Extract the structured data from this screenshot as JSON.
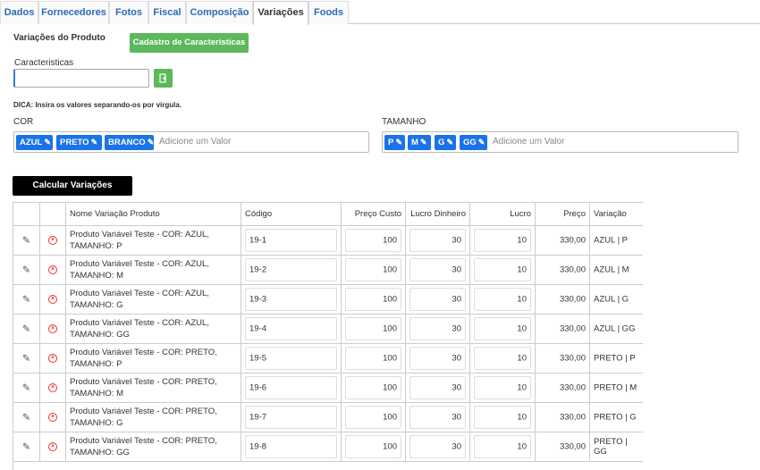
{
  "tabs": [
    "Dados",
    "Fornecedores",
    "Fotos",
    "Fiscal",
    "Composição",
    "Variações",
    "Foods"
  ],
  "active_tab": "Variações",
  "section_title": "Variações do Produto",
  "cadastro_button": "Cadastro de Características",
  "caracteristicas_label": "Caracteristicas",
  "caracteristicas_value": "",
  "dica": "DICA: Insira os valores separando-os por vírgula.",
  "cor": {
    "label": "COR",
    "tags": [
      "AZUL",
      "PRETO",
      "BRANCO"
    ],
    "placeholder": "Adicione um Valor"
  },
  "tamanho": {
    "label": "TAMANHO",
    "tags": [
      "P",
      "M",
      "G",
      "GG"
    ],
    "placeholder": "Adicione um Valor"
  },
  "calcular_button": "Calcular Variações",
  "colors": {
    "tab_link": "#2a6bb5",
    "green": "#5cb85c",
    "tag_blue": "#1a73e8",
    "delete_red": "#e33"
  },
  "table": {
    "headers": [
      "Nome Variação Produto",
      "Código",
      "Preço Custo",
      "Lucro Dinheiro",
      "Lucro Percentual",
      "Preço Venda",
      "Variação"
    ],
    "rows": [
      {
        "name": "Produto Variável Teste - COR: AZUL, TAMANHO: P",
        "codigo": "19-1",
        "custo": "100",
        "lucro_dinheiro": "30",
        "lucro_percentual": "10",
        "venda": "330,00",
        "variacao": "AZUL | P"
      },
      {
        "name": "Produto Variável Teste - COR: AZUL, TAMANHO: M",
        "codigo": "19-2",
        "custo": "100",
        "lucro_dinheiro": "30",
        "lucro_percentual": "10",
        "venda": "330,00",
        "variacao": "AZUL | M"
      },
      {
        "name": "Produto Variável Teste - COR: AZUL, TAMANHO: G",
        "codigo": "19-3",
        "custo": "100",
        "lucro_dinheiro": "30",
        "lucro_percentual": "10",
        "venda": "330,00",
        "variacao": "AZUL | G"
      },
      {
        "name": "Produto Variável Teste - COR: AZUL, TAMANHO: GG",
        "codigo": "19-4",
        "custo": "100",
        "lucro_dinheiro": "30",
        "lucro_percentual": "10",
        "venda": "330,00",
        "variacao": "AZUL | GG"
      },
      {
        "name": "Produto Variável Teste - COR: PRETO, TAMANHO: P",
        "codigo": "19-5",
        "custo": "100",
        "lucro_dinheiro": "30",
        "lucro_percentual": "10",
        "venda": "330,00",
        "variacao": "PRETO | P"
      },
      {
        "name": "Produto Variável Teste - COR: PRETO, TAMANHO: M",
        "codigo": "19-6",
        "custo": "100",
        "lucro_dinheiro": "30",
        "lucro_percentual": "10",
        "venda": "330,00",
        "variacao": "PRETO | M"
      },
      {
        "name": "Produto Variável Teste - COR: PRETO, TAMANHO: G",
        "codigo": "19-7",
        "custo": "100",
        "lucro_dinheiro": "30",
        "lucro_percentual": "10",
        "venda": "330,00",
        "variacao": "PRETO | G"
      },
      {
        "name": "Produto Variável Teste - COR: PRETO, TAMANHO: GG",
        "codigo": "19-8",
        "custo": "100",
        "lucro_dinheiro": "30",
        "lucro_percentual": "10",
        "venda": "330,00",
        "variacao": "PRETO | GG"
      }
    ]
  }
}
